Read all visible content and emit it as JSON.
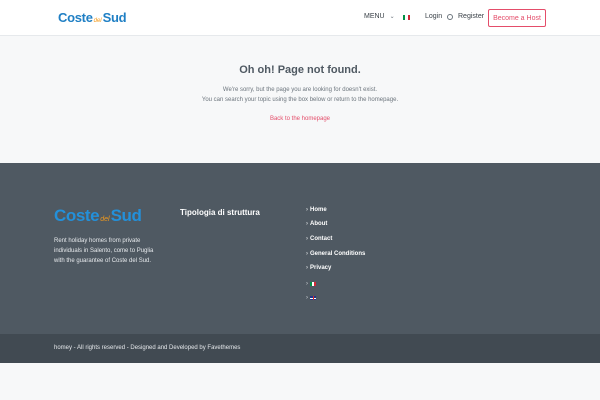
{
  "header": {
    "logo": {
      "part1": "Coste",
      "part2": "del",
      "part3": "Sud"
    },
    "menu_label": "MENU",
    "menu_chevron": "⌄",
    "language_flag": "italian-flag",
    "login_label": "Login",
    "register_label": "Register",
    "host_button_label": "Become a Host"
  },
  "not_found": {
    "title": "Oh oh! Page not found.",
    "message_line1": "We're sorry, but the page you are looking for doesn't exist.",
    "message_line2": "You can search your topic using the box below or return to the homepage.",
    "back_link": "Back to the homepage"
  },
  "footer": {
    "logo": {
      "part1": "Coste",
      "part2": "del",
      "part3": "Sud"
    },
    "description_lines": [
      "Rent holiday homes from private",
      "individuals in Salento, come to Puglia",
      "with the guarantee of Coste del Sud."
    ],
    "column_heading": "Tipologia di struttura",
    "links": [
      "Home",
      "About",
      "Contact",
      "General Conditions",
      "Privacy"
    ],
    "link_arrow": "›",
    "languages": [
      "italian-flag",
      "uk-flag"
    ],
    "copyright": "homey - All rights reserved - Designed and Developed by Favethemes"
  },
  "colors": {
    "brand_blue": "#1f7fc4",
    "brand_orange": "#f39a1b",
    "accent_pink": "#e44d6a",
    "footer_bg": "#4f5962",
    "subfooter_bg": "#414a52"
  }
}
